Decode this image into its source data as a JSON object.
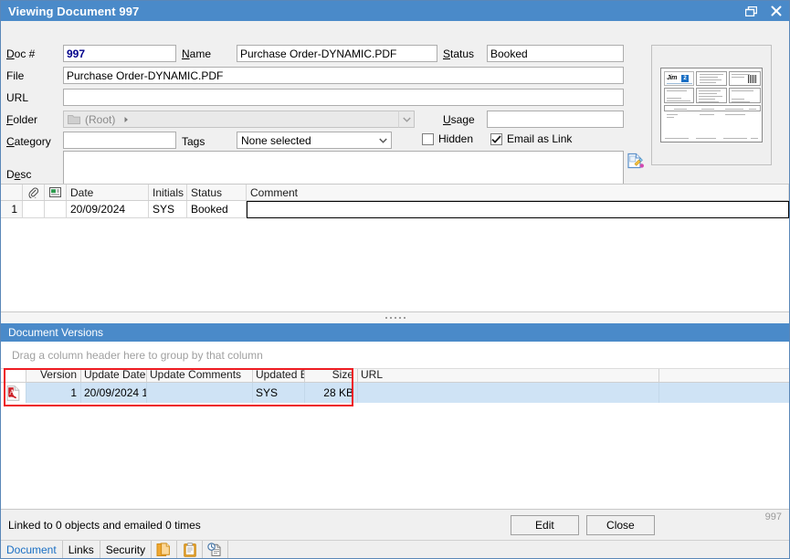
{
  "window": {
    "title": "Viewing Document 997",
    "restore_icon": "restore-icon",
    "close_icon": "close-icon"
  },
  "form": {
    "doc_number": {
      "label": "Doc #",
      "value": "997"
    },
    "name": {
      "label": "Name",
      "value": "Purchase Order-DYNAMIC.PDF"
    },
    "status": {
      "label": "Status",
      "value": "Booked"
    },
    "file": {
      "label": "File",
      "value": "Purchase Order-DYNAMIC.PDF"
    },
    "url": {
      "label": "URL",
      "value": ""
    },
    "folder": {
      "label": "Folder",
      "value": "(Root)"
    },
    "usage": {
      "label": "Usage",
      "value": ""
    },
    "category": {
      "label": "Category",
      "value": ""
    },
    "tags": {
      "label": "Tags",
      "value": "None selected"
    },
    "hidden": {
      "label": "Hidden",
      "checked": false
    },
    "email_as_link": {
      "label": "Email as Link",
      "checked": true
    },
    "desc": {
      "label": "Desc",
      "value": ""
    },
    "edit_preview_icon": "image-edit-icon",
    "thumbnail": {
      "logo_text": "Jim",
      "logo_badge": "2"
    }
  },
  "comment_grid": {
    "columns": [
      "",
      "attachment-icon",
      "note-icon",
      "Date",
      "Initials",
      "Status",
      "Comment"
    ],
    "rows": [
      {
        "index": "1",
        "attachment": "",
        "note": "",
        "date": "20/09/2024",
        "initials": "SYS",
        "status": "Booked",
        "comment": ""
      }
    ]
  },
  "versions": {
    "section_title": "Document Versions",
    "group_hint": "Drag a column header here to group by that column",
    "columns": [
      "",
      "Version",
      "Update Date",
      "Update Comments",
      "Updated By",
      "Size",
      "URL"
    ],
    "rows": [
      {
        "icon": "pdf-icon",
        "version": "1",
        "update_date": "20/09/2024 1",
        "update_comments": "",
        "updated_by": "SYS",
        "size": "28 KB",
        "url": ""
      }
    ]
  },
  "footer": {
    "status_text": "Linked to 0 objects and emailed 0 times",
    "edit_label": "Edit",
    "close_label": "Close",
    "doc_number": "997"
  },
  "tabs": {
    "items": [
      {
        "label": "Document",
        "active": true
      },
      {
        "label": "Links",
        "active": false
      },
      {
        "label": "Security",
        "active": false
      }
    ],
    "icons": [
      "copy-documents-icon",
      "clipboard-icon",
      "document-history-icon"
    ]
  },
  "colors": {
    "title_bar": "#4a8ac9",
    "section_bar": "#4a8ac9",
    "selection_row": "#cfe3f5",
    "annotation": "#ee1c22",
    "accent_text": "#1a6fc4"
  }
}
